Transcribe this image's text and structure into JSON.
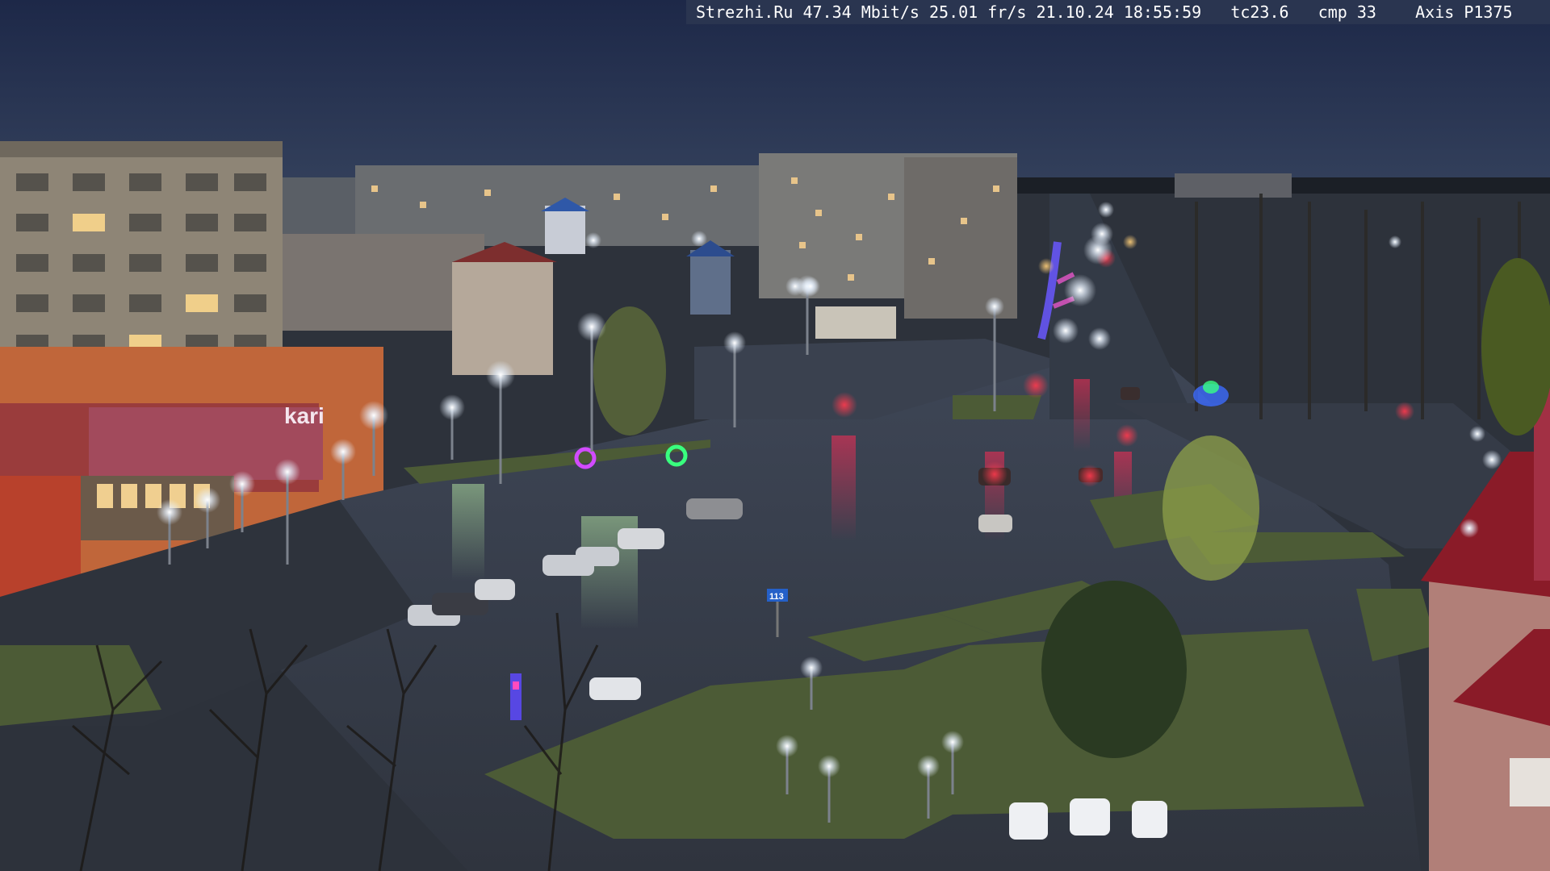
{
  "overlay": {
    "site": "Strezhi.Ru",
    "bitrate": "47.34 Mbit/s",
    "framerate": "25.01 fr/s",
    "datetime": "21.10.24 18:55:59",
    "tc": "tc23.6",
    "cmp": "cmp 33",
    "camera": "Axis P1375"
  },
  "signs": {
    "store": "kari",
    "bus_stop": "113"
  },
  "colors": {
    "sky": "#253252",
    "asphalt": "#3d4452",
    "grass": "#4b5c35",
    "streetlight": "#f4f8ff",
    "brake_light": "#ff3048",
    "festive_blue": "#6a58ff",
    "green_ring": "#39ff7e",
    "pink_ring": "#d24bff"
  }
}
